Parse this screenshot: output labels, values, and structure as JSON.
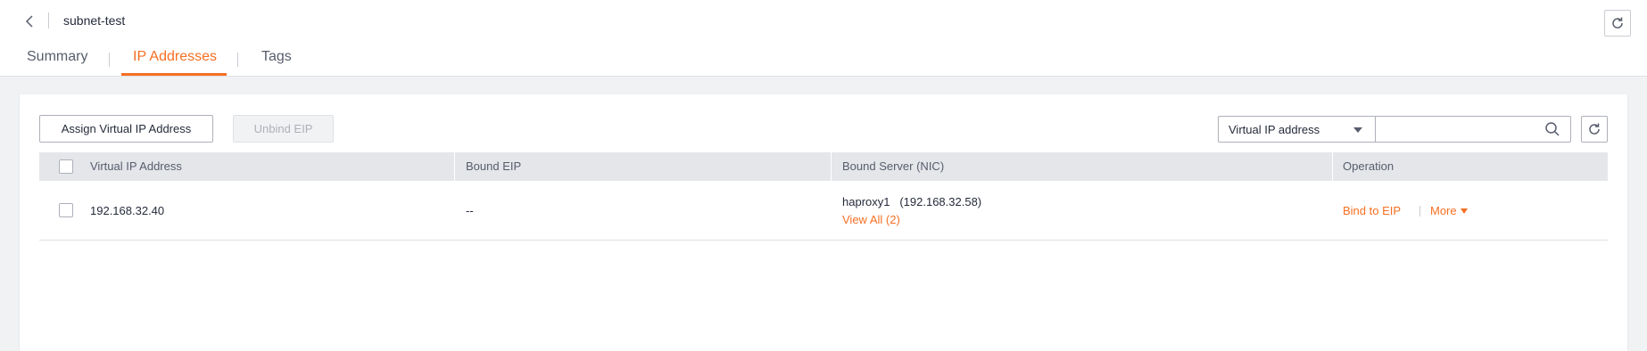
{
  "header": {
    "title": "subnet-test"
  },
  "tabs": [
    {
      "label": "Summary",
      "active": false
    },
    {
      "label": "IP Addresses",
      "active": true
    },
    {
      "label": "Tags",
      "active": false
    }
  ],
  "toolbar": {
    "assign_label": "Assign Virtual IP Address",
    "unbind_label": "Unbind EIP",
    "filter_selected": "Virtual IP address",
    "search_value": ""
  },
  "table": {
    "columns": [
      "Virtual IP Address",
      "Bound EIP",
      "Bound Server (NIC)",
      "Operation"
    ],
    "rows": [
      {
        "virtual_ip": "192.168.32.40",
        "bound_eip": "--",
        "server_name": "haproxy1",
        "server_ip": "(192.168.32.58)",
        "view_all": "View All (2)",
        "bind_action": "Bind to EIP",
        "more_action": "More"
      }
    ]
  },
  "colors": {
    "accent": "#f66f22",
    "text": "#252b3a",
    "secondary_text": "#575d6c",
    "table_header": "#e4e6ea",
    "page_background": "#f1f2f4"
  },
  "icons": {
    "back": "chevron-left-icon",
    "refresh": "refresh-icon",
    "search": "search-icon",
    "dropdown": "caret-down-icon"
  }
}
